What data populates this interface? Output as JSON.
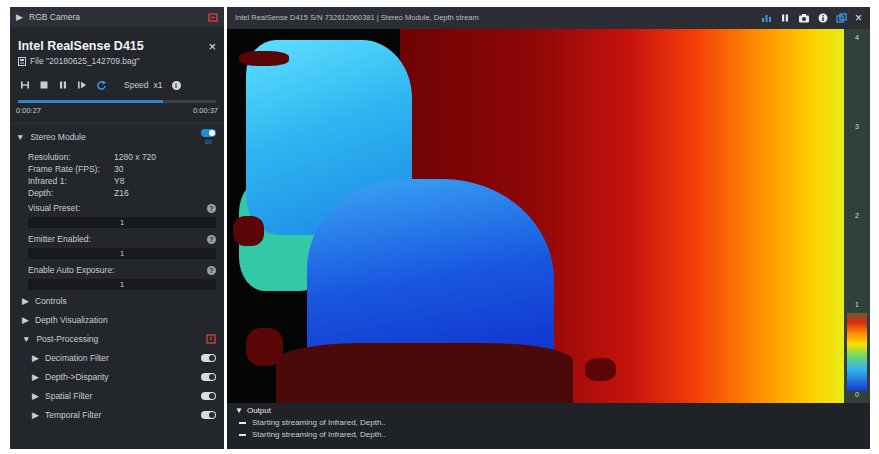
{
  "rgb_camera": {
    "arrow": "▶",
    "label": "RGB Camera"
  },
  "device": {
    "title": "Intel RealSense D415",
    "close": "×",
    "file": "File \"20180625_142709.bag\""
  },
  "playback": {
    "speed_label": "Speed",
    "speed": "x1",
    "info": "i",
    "elapsed": "0:00:27",
    "total": "0:00:37",
    "level": 0.73
  },
  "stereo": {
    "arrow": "▼",
    "label": "Stereo Module",
    "on": true,
    "toggle_label": "on",
    "info": [
      {
        "label": "Resolution:",
        "value": "1280 x 720"
      },
      {
        "label": "Frame Rate (FPS):",
        "value": "30"
      },
      {
        "label": "Infrared 1:",
        "value": "Y8"
      },
      {
        "label": "Depth:",
        "value": "Z16"
      }
    ],
    "options": [
      {
        "label": "Visual Preset:",
        "help": "?",
        "value": "1"
      },
      {
        "label": "Emitter Enabled:",
        "help": "?",
        "value": "1"
      },
      {
        "label": "Enable Auto Exposure:",
        "help": "?",
        "value": "1"
      }
    ]
  },
  "sections": [
    {
      "arrow": "▶",
      "label": "Controls",
      "kind": "plain"
    },
    {
      "arrow": "▶",
      "label": "Depth Visualization",
      "kind": "plain"
    },
    {
      "arrow": "▼",
      "label": "Post-Processing",
      "kind": "iconed"
    }
  ],
  "filters": [
    {
      "arrow": "▶",
      "label": "Decimation Filter",
      "on": true
    },
    {
      "arrow": "▶",
      "label": "Depth->Disparity",
      "on": true
    },
    {
      "arrow": "▶",
      "label": "Spatial Filter",
      "on": true
    },
    {
      "arrow": "▶",
      "label": "Temporal Filter",
      "on": true
    }
  ],
  "view": {
    "title": "Intel RealSense D415 S/N 732612060381 | Stereo Module, Depth stream",
    "close": "×",
    "colorbar_ticks": [
      "4",
      "3",
      "2",
      "1",
      "0"
    ]
  },
  "output": {
    "arrow": "▼",
    "label": "Output",
    "lines": [
      "Starting streaming of Infrared, Depth..",
      "Starting streaming of Infrared, Depth.."
    ]
  }
}
